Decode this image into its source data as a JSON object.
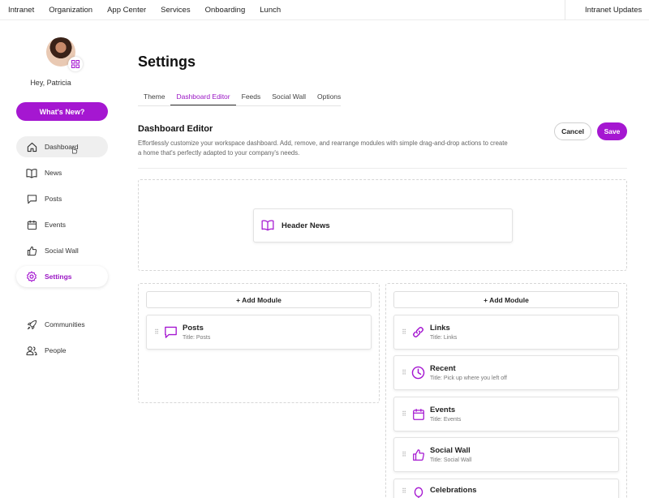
{
  "topnav": {
    "items": [
      "Intranet",
      "Organization",
      "App Center",
      "Services",
      "Onboarding",
      "Lunch"
    ],
    "updates": "Intranet Updates"
  },
  "sidebar": {
    "greeting": "Hey, Patricia",
    "whats_new": "What's New?",
    "items": [
      {
        "label": "Dashboard",
        "icon": "home-icon"
      },
      {
        "label": "News",
        "icon": "book-icon"
      },
      {
        "label": "Posts",
        "icon": "chat-icon"
      },
      {
        "label": "Events",
        "icon": "calendar-icon"
      },
      {
        "label": "Social Wall",
        "icon": "thumbs-up-icon"
      },
      {
        "label": "Settings",
        "icon": "gear-icon"
      },
      {
        "label": "Communities",
        "icon": "rocket-icon"
      },
      {
        "label": "People",
        "icon": "people-icon"
      }
    ]
  },
  "main": {
    "title": "Settings",
    "tabs": [
      "Theme",
      "Dashboard Editor",
      "Feeds",
      "Social Wall",
      "Options"
    ],
    "active_tab": "Dashboard Editor",
    "section_title": "Dashboard Editor",
    "section_desc": "Effortlessly customize your workspace dashboard. Add, remove, and rearrange modules with simple drag-and-drop actions to create a home that's perfectly adapted to your company's needs.",
    "cancel": "Cancel",
    "save": "Save",
    "header_module": "Header News",
    "add_module": "+ Add Module",
    "left_modules": [
      {
        "name": "Posts",
        "sub": "Title: Posts",
        "icon": "chat-icon"
      }
    ],
    "right_modules": [
      {
        "name": "Links",
        "sub": "Title: Links",
        "icon": "link-icon"
      },
      {
        "name": "Recent",
        "sub": "Title: Pick up where you left off",
        "icon": "clock-icon"
      },
      {
        "name": "Events",
        "sub": "Title: Events",
        "icon": "calendar-icon"
      },
      {
        "name": "Social Wall",
        "sub": "Title: Social Wall",
        "icon": "thumbs-up-icon"
      },
      {
        "name": "Celebrations",
        "sub": "",
        "icon": "balloon-icon"
      }
    ]
  },
  "colors": {
    "accent": "#a517d1",
    "accent_text": "#9a16c4"
  }
}
